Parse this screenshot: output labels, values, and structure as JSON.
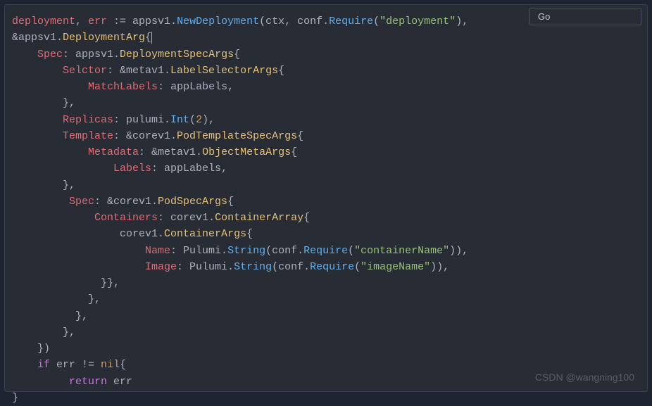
{
  "language_label": "Go",
  "watermark": "CSDN @wangning100",
  "code": {
    "l1": {
      "a": "deployment",
      "b": ", ",
      "c": "err",
      "d": " := appsv1.",
      "e": "NewDeployment",
      "f": "(ctx, conf.",
      "g": "Require",
      "h": "(",
      "i": "\"deployment\"",
      "j": "),"
    },
    "l2": {
      "a": "&appsv1.",
      "b": "DeploymentArg",
      "c": "{"
    },
    "l3": {
      "a": "    ",
      "b": "Spec",
      "c": ": appsv1.",
      "d": "DeploymentSpecArgs",
      "e": "{"
    },
    "l4": {
      "a": "        ",
      "b": "Selctor",
      "c": ": &metav1.",
      "d": "LabelSelectorArgs",
      "e": "{"
    },
    "l5": {
      "a": "            ",
      "b": "MatchLabels",
      "c": ": appLabels,"
    },
    "l6": {
      "a": "        },"
    },
    "l7": {
      "a": "        ",
      "b": "Replicas",
      "c": ": pulumi.",
      "d": "Int",
      "e": "(",
      "f": "2",
      "g": "),"
    },
    "l8": {
      "a": "        ",
      "b": "Template",
      "c": ": &corev1.",
      "d": "PodTemplateSpecArgs",
      "e": "{"
    },
    "l9": {
      "a": "            ",
      "b": "Metadata",
      "c": ": &metav1.",
      "d": "ObjectMetaArgs",
      "e": "{"
    },
    "l10": {
      "a": "                ",
      "b": "Labels",
      "c": ": appLabels,"
    },
    "l11": {
      "a": "        },"
    },
    "l12": {
      "a": "         ",
      "b": "Spec",
      "c": ": &corev1.",
      "d": "PodSpecArgs",
      "e": "{"
    },
    "l13": {
      "a": "             ",
      "b": "Containers",
      "c": ": corev1.",
      "d": "ContainerArray",
      "e": "{"
    },
    "l14": {
      "a": "                 corev1.",
      "b": "ContainerArgs",
      "c": "{"
    },
    "l15": {
      "a": "                     ",
      "b": "Name",
      "c": ": Pulumi.",
      "d": "String",
      "e": "(conf.",
      "f": "Require",
      "g": "(",
      "h": "\"containerName\"",
      "i": ")),"
    },
    "l16": {
      "a": "                     ",
      "b": "Image",
      "c": ": Pulumi.",
      "d": "String",
      "e": "(conf.",
      "f": "Require",
      "g": "(",
      "h": "\"imageName\"",
      "i": ")),"
    },
    "l17": {
      "a": "              }},"
    },
    "l18": {
      "a": "            },"
    },
    "l19": {
      "a": "          },"
    },
    "l20": {
      "a": "        },"
    },
    "l21": {
      "a": "    })"
    },
    "l22": {
      "a": "    ",
      "b": "if",
      "c": " err != ",
      "d": "nil",
      "e": "{"
    },
    "l23": {
      "a": "         ",
      "b": "return",
      "c": " err"
    },
    "l24": {
      "a": "}"
    }
  }
}
